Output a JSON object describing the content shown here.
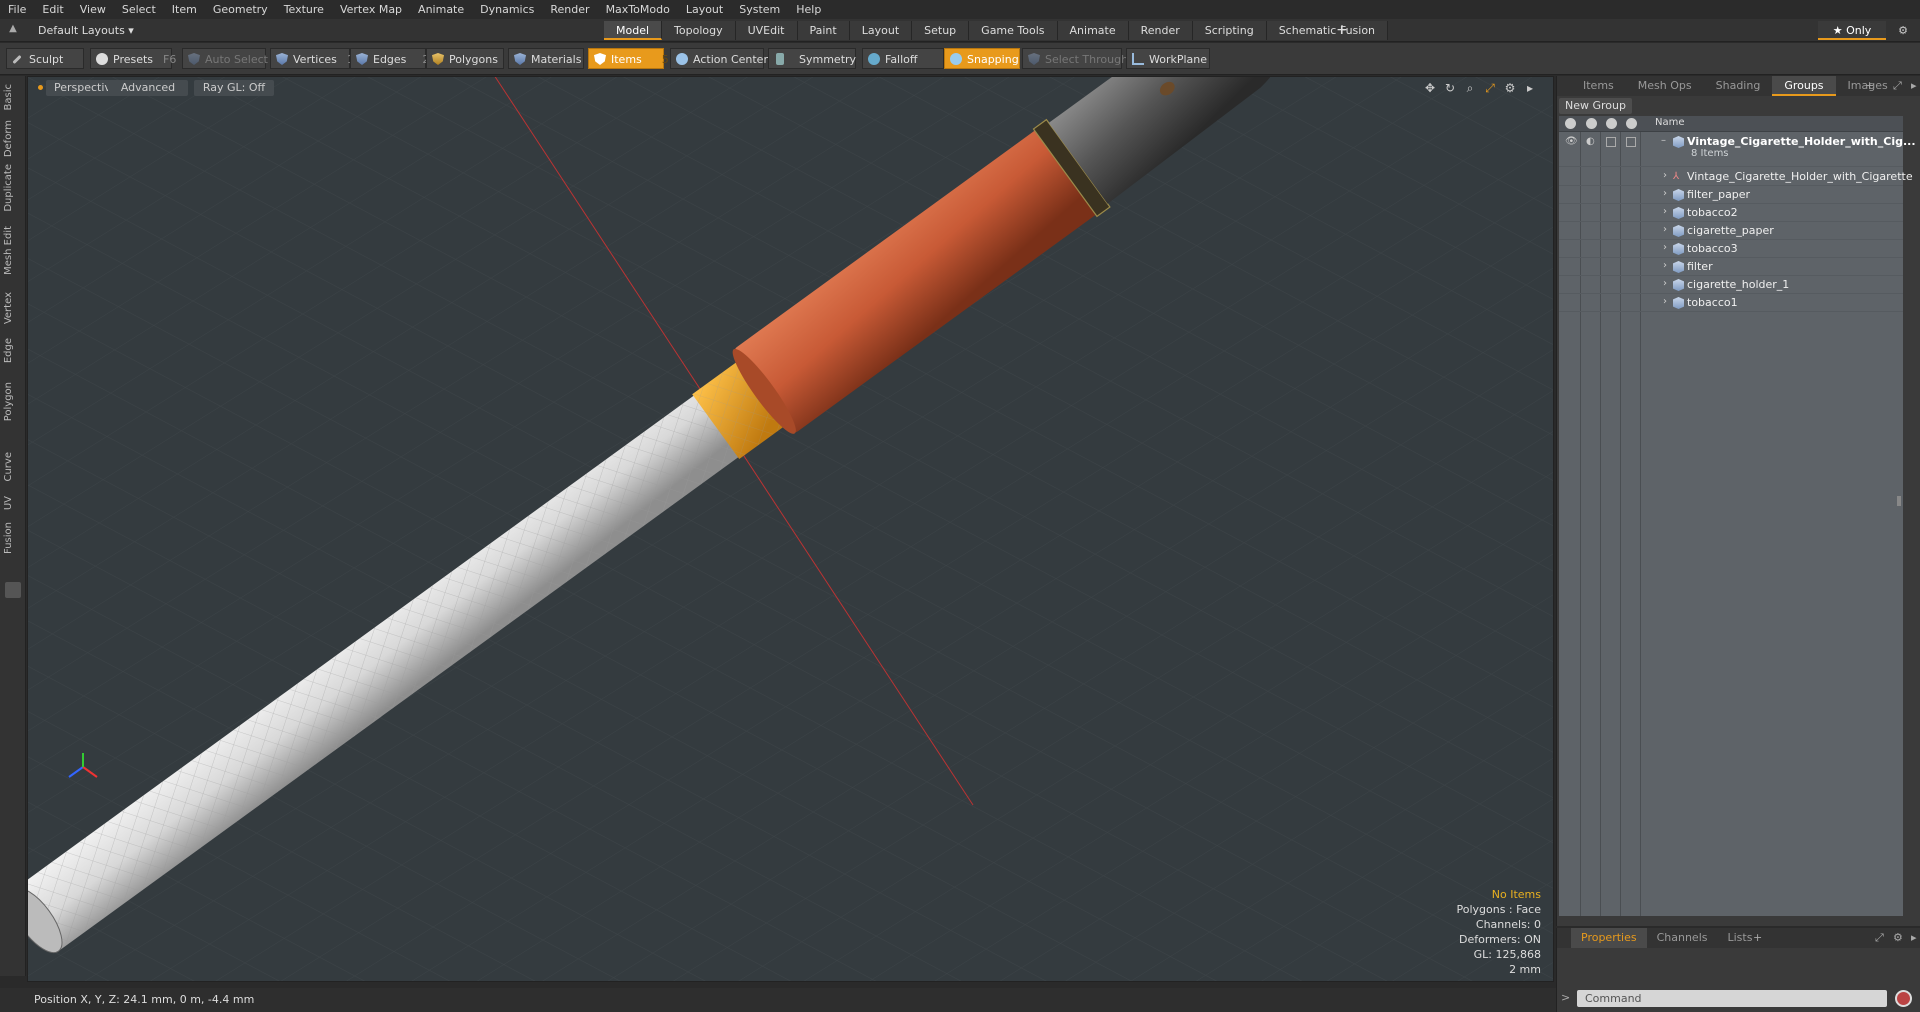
{
  "menu": [
    "File",
    "Edit",
    "View",
    "Select",
    "Item",
    "Geometry",
    "Texture",
    "Vertex Map",
    "Animate",
    "Dynamics",
    "Render",
    "MaxToModo",
    "Layout",
    "System",
    "Help"
  ],
  "layouts_label": "Default Layouts ▾",
  "layout_tabs": [
    "Model",
    "Topology",
    "UVEdit",
    "Paint",
    "Layout",
    "Setup",
    "Game Tools",
    "Animate",
    "Render",
    "Scripting",
    "Schematic Fusion"
  ],
  "layout_active": "Model",
  "plus_label": "+",
  "only_label": "★ Only",
  "toolbar": {
    "sculpt": "Sculpt",
    "presets": "Presets",
    "presets_key": "F6",
    "auto_select": "Auto Select",
    "vertices": "Vertices",
    "vertices_count": "1",
    "edges": "Edges",
    "edges_count": "2",
    "polygons": "Polygons",
    "materials": "Materials",
    "items": "Items",
    "items_count": "5",
    "action_center": "Action Center",
    "symmetry": "Symmetry",
    "falloff": "Falloff",
    "snapping": "Snapping",
    "select_through": "Select Through",
    "workplane": "WorkPlane"
  },
  "left_tabs": [
    "Basic",
    "Deform",
    "Duplicate",
    "Mesh Edit",
    "Vertex",
    "Edge",
    "Polygon",
    "Curve",
    "UV",
    "Fusion"
  ],
  "viewport": {
    "perspective": "Perspective",
    "advanced": "Advanced",
    "raygl": "Ray GL: Off",
    "stats": {
      "no_items": "No Items",
      "polygons": "Polygons : Face",
      "channels": "Channels: 0",
      "deformers": "Deformers: ON",
      "gl": "GL: 125,868",
      "scale": "2 mm"
    }
  },
  "right_tabs": [
    "Items",
    "Mesh Ops",
    "Shading",
    "Groups",
    "Images"
  ],
  "right_active": "Groups",
  "new_group": "New Group",
  "tree": {
    "name_header": "Name",
    "group": "Vintage_Cigarette_Holder_with_Cig...",
    "group_count": "8 Items",
    "items": [
      "Vintage_Cigarette_Holder_with_Cigarette",
      "filter_paper",
      "tobacco2",
      "cigarette_paper",
      "tobacco3",
      "filter",
      "cigarette_holder_1",
      "tobacco1"
    ]
  },
  "bottom_tabs": [
    "Properties",
    "Channels",
    "Lists"
  ],
  "bottom_active": "Properties",
  "command_placeholder": "Command",
  "status": "Position X, Y, Z:   24.1 mm, 0 m, -4.4 mm"
}
